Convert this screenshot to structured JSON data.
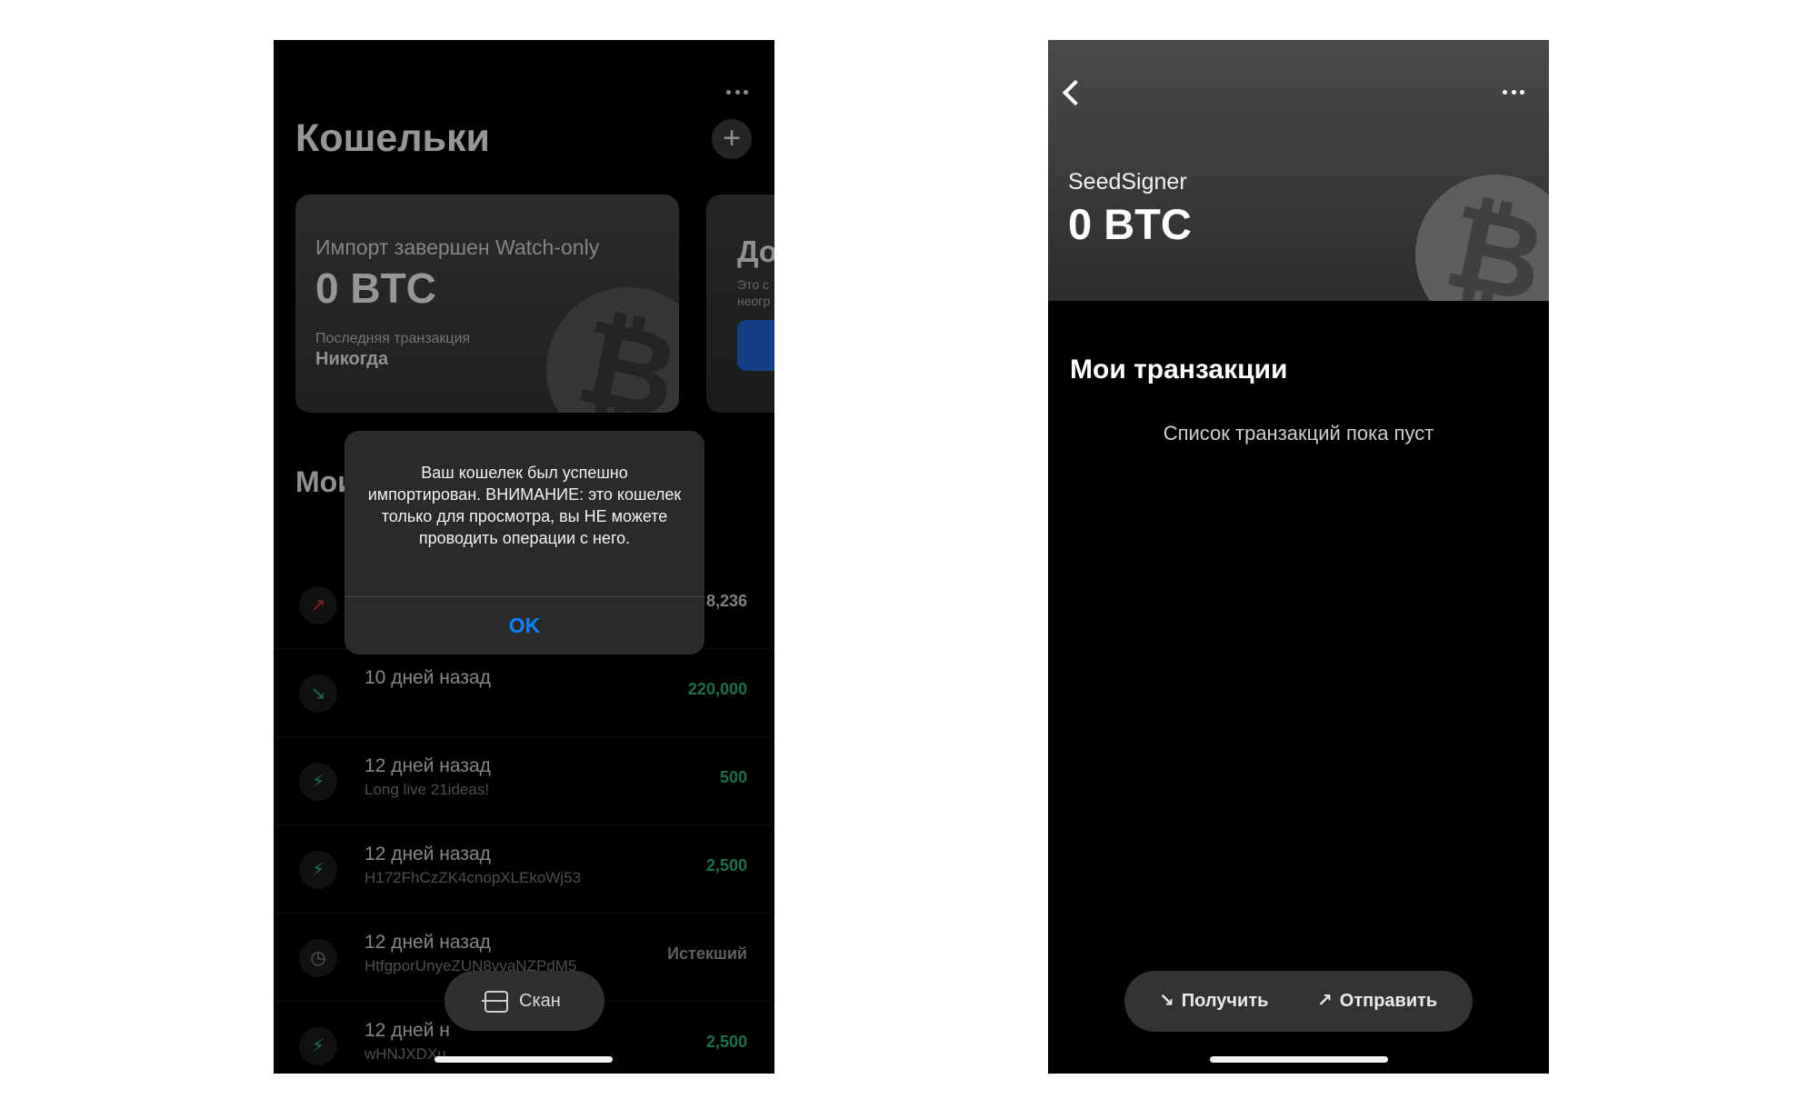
{
  "left": {
    "screen_title": "Кошельки",
    "add_symbol": "+",
    "wallet_card": {
      "label": "Импорт завершен Watch-only",
      "balance": "0 BTC",
      "last_tx_label": "Последняя транзакция",
      "last_tx_value": "Никогда",
      "coin_symbol": "₿"
    },
    "second_card": {
      "title": "До",
      "desc": "Это с неогр"
    },
    "section_title": "Мои",
    "transactions": [
      {
        "icon": "↗",
        "icon_color": "#e0332e",
        "date": "",
        "memo": "",
        "amount": "8,236",
        "amount_color": "#cfcfcf"
      },
      {
        "icon": "↘",
        "icon_color": "#2bb673",
        "date": "10 дней назад",
        "memo": "",
        "amount": "220,000",
        "amount_color": "#2bb673"
      },
      {
        "icon": "⚡",
        "icon_color": "#2bb673",
        "date": "12 дней назад",
        "memo": "Long live 21ideas!",
        "amount": "500",
        "amount_color": "#2bb673"
      },
      {
        "icon": "⚡",
        "icon_color": "#2bb673",
        "date": "12 дней назад",
        "memo": "H172FhCzZK4cnopXLEkoWj53",
        "amount": "2,500",
        "amount_color": "#2bb673"
      },
      {
        "icon": "◷",
        "icon_color": "#9a9a9a",
        "date": "12 дней назад",
        "memo": "HtfgporUnyeZUN8vvaNZPdM5",
        "amount": "Истекший",
        "amount_color": "#9a9a9a"
      },
      {
        "icon": "⚡",
        "icon_color": "#2bb673",
        "date": "12 дней н",
        "memo": "wHNJXDXu",
        "amount": "2,500",
        "amount_color": "#2bb673"
      }
    ],
    "alert": {
      "message": "Ваш кошелек был успешно импортирован. ВНИМАНИЕ: это кошелек только для просмотра, вы НЕ можете проводить операции с него.",
      "ok_label": "OK"
    },
    "scan_label": "Скан"
  },
  "right": {
    "wallet_name": "SeedSigner",
    "balance": "0 BTC",
    "coin_symbol": "₿",
    "tx_title": "Мои транзакции",
    "empty_text": "Список транзакций пока пуст",
    "receive_label": "Получить",
    "send_label": "Отправить",
    "receive_arrow": "↘",
    "send_arrow": "↗"
  }
}
